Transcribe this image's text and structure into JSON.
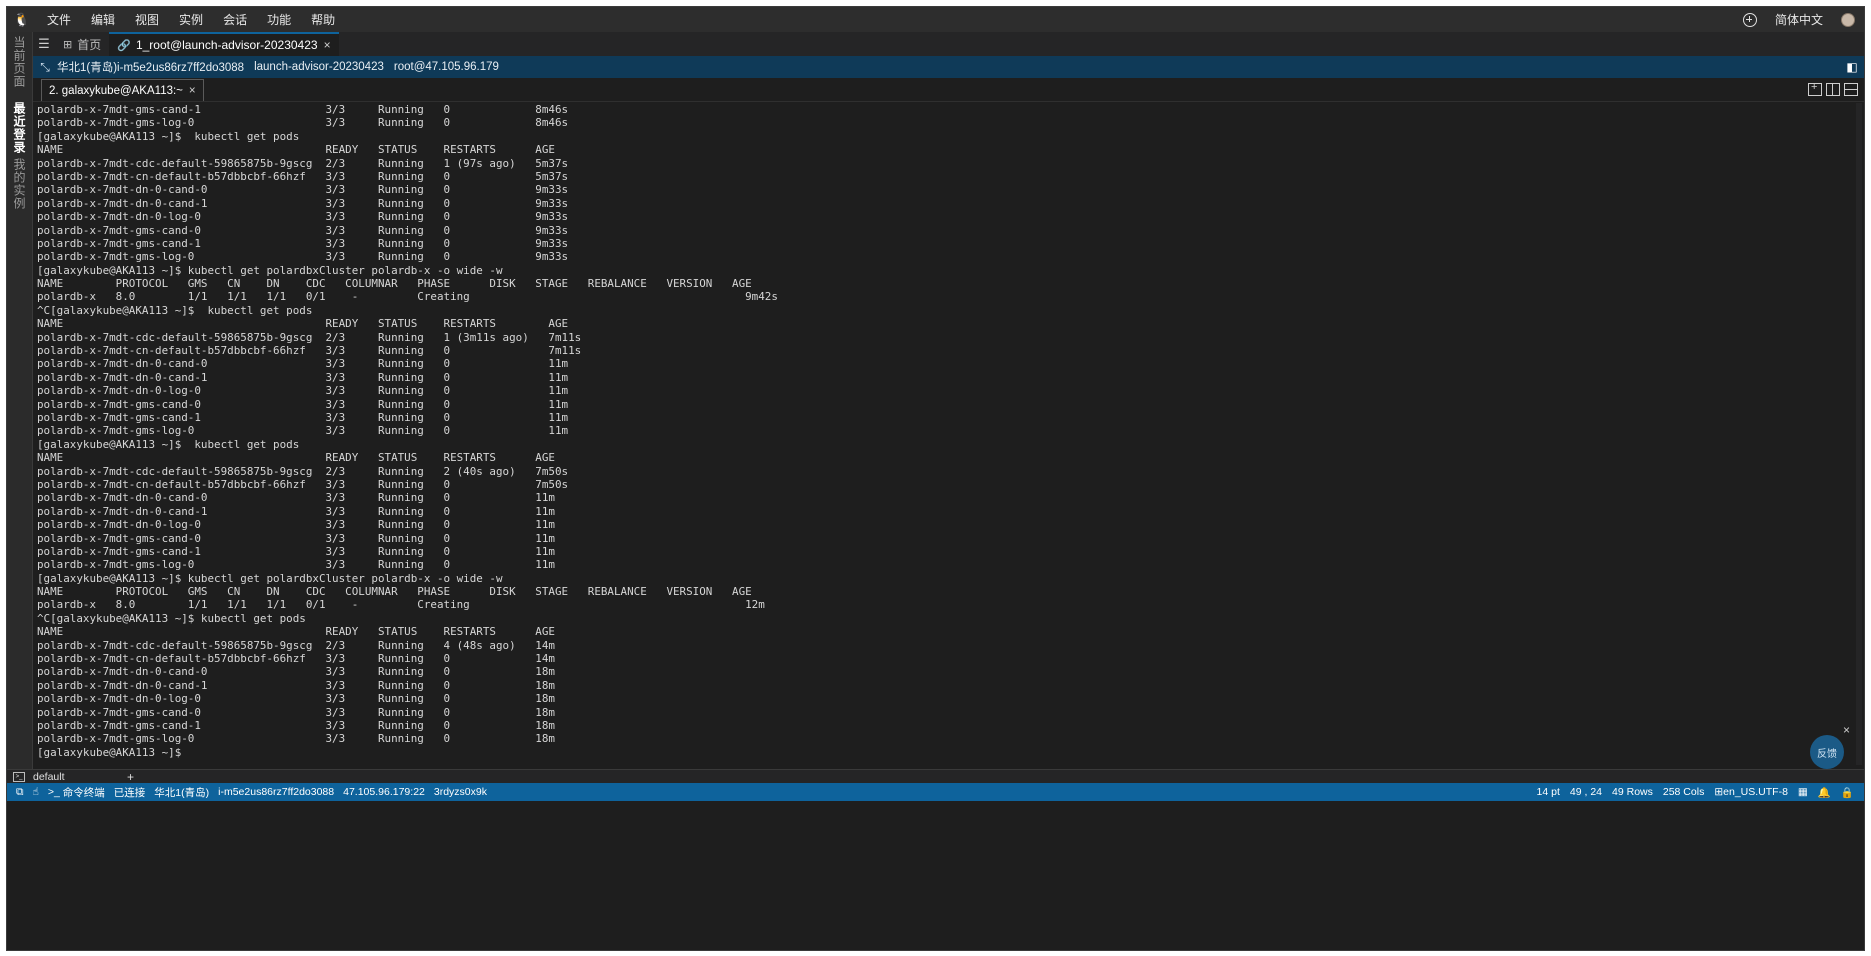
{
  "menubar": {
    "items": [
      "文件",
      "编辑",
      "视图",
      "实例",
      "会话",
      "功能",
      "帮助"
    ],
    "language": "简体中文"
  },
  "siderail": {
    "current_page": "当前页面",
    "recent": "最近登录",
    "my_instances": "我的实例"
  },
  "tabs": {
    "home": "首页",
    "session": "1_root@launch-advisor-20230423"
  },
  "infobar": {
    "region": "华北1(青岛)i-m5e2us86rz7ff2do3088",
    "instance_name": "launch-advisor-20230423",
    "login": "root@47.105.96.179"
  },
  "terminal_tab": {
    "label": "2. galaxykube@AKA113:~"
  },
  "terminal_lines": [
    "polardb-x-7mdt-gms-cand-1                   3/3     Running   0             8m46s",
    "polardb-x-7mdt-gms-log-0                    3/3     Running   0             8m46s",
    "[galaxykube@AKA113 ~]$  kubectl get pods",
    "NAME                                        READY   STATUS    RESTARTS      AGE",
    "polardb-x-7mdt-cdc-default-59865875b-9gscg  2/3     Running   1 (97s ago)   5m37s",
    "polardb-x-7mdt-cn-default-b57dbbcbf-66hzf   3/3     Running   0             5m37s",
    "polardb-x-7mdt-dn-0-cand-0                  3/3     Running   0             9m33s",
    "polardb-x-7mdt-dn-0-cand-1                  3/3     Running   0             9m33s",
    "polardb-x-7mdt-dn-0-log-0                   3/3     Running   0             9m33s",
    "polardb-x-7mdt-gms-cand-0                   3/3     Running   0             9m33s",
    "polardb-x-7mdt-gms-cand-1                   3/3     Running   0             9m33s",
    "polardb-x-7mdt-gms-log-0                    3/3     Running   0             9m33s",
    "[galaxykube@AKA113 ~]$ kubectl get polardbxCluster polardb-x -o wide -w",
    "NAME        PROTOCOL   GMS   CN    DN    CDC   COLUMNAR   PHASE      DISK   STAGE   REBALANCE   VERSION   AGE",
    "polardb-x   8.0        1/1   1/1   1/1   0/1    -         Creating                                          9m42s",
    "^C[galaxykube@AKA113 ~]$  kubectl get pods",
    "NAME                                        READY   STATUS    RESTARTS        AGE",
    "polardb-x-7mdt-cdc-default-59865875b-9gscg  2/3     Running   1 (3m11s ago)   7m11s",
    "polardb-x-7mdt-cn-default-b57dbbcbf-66hzf   3/3     Running   0               7m11s",
    "polardb-x-7mdt-dn-0-cand-0                  3/3     Running   0               11m",
    "polardb-x-7mdt-dn-0-cand-1                  3/3     Running   0               11m",
    "polardb-x-7mdt-dn-0-log-0                   3/3     Running   0               11m",
    "polardb-x-7mdt-gms-cand-0                   3/3     Running   0               11m",
    "polardb-x-7mdt-gms-cand-1                   3/3     Running   0               11m",
    "polardb-x-7mdt-gms-log-0                    3/3     Running   0               11m",
    "[galaxykube@AKA113 ~]$  kubectl get pods",
    "NAME                                        READY   STATUS    RESTARTS      AGE",
    "polardb-x-7mdt-cdc-default-59865875b-9gscg  2/3     Running   2 (40s ago)   7m50s",
    "polardb-x-7mdt-cn-default-b57dbbcbf-66hzf   3/3     Running   0             7m50s",
    "polardb-x-7mdt-dn-0-cand-0                  3/3     Running   0             11m",
    "polardb-x-7mdt-dn-0-cand-1                  3/3     Running   0             11m",
    "polardb-x-7mdt-dn-0-log-0                   3/3     Running   0             11m",
    "polardb-x-7mdt-gms-cand-0                   3/3     Running   0             11m",
    "polardb-x-7mdt-gms-cand-1                   3/3     Running   0             11m",
    "polardb-x-7mdt-gms-log-0                    3/3     Running   0             11m",
    "[galaxykube@AKA113 ~]$ kubectl get polardbxCluster polardb-x -o wide -w",
    "NAME        PROTOCOL   GMS   CN    DN    CDC   COLUMNAR   PHASE      DISK   STAGE   REBALANCE   VERSION   AGE",
    "polardb-x   8.0        1/1   1/1   1/1   0/1    -         Creating                                          12m",
    "^C[galaxykube@AKA113 ~]$ kubectl get pods",
    "NAME                                        READY   STATUS    RESTARTS      AGE",
    "polardb-x-7mdt-cdc-default-59865875b-9gscg  2/3     Running   4 (48s ago)   14m",
    "polardb-x-7mdt-cn-default-b57dbbcbf-66hzf   3/3     Running   0             14m",
    "polardb-x-7mdt-dn-0-cand-0                  3/3     Running   0             18m",
    "polardb-x-7mdt-dn-0-cand-1                  3/3     Running   0             18m",
    "polardb-x-7mdt-dn-0-log-0                   3/3     Running   0             18m",
    "polardb-x-7mdt-gms-cand-0                   3/3     Running   0             18m",
    "polardb-x-7mdt-gms-cand-1                   3/3     Running   0             18m",
    "polardb-x-7mdt-gms-log-0                    3/3     Running   0             18m",
    "[galaxykube@AKA113 ~]$ "
  ],
  "feedback": "反馈",
  "panel": {
    "name": "default"
  },
  "statusbar": {
    "command_terminal": "命令终端",
    "connection": "已连接",
    "region": "华北1(青岛)",
    "instance_id": "i-m5e2us86rz7ff2do3088",
    "address": "47.105.96.179:22",
    "session_id": "3rdyzs0x9k",
    "font_size": "14 pt",
    "cursor": "49 , 24",
    "rows": "49 Rows",
    "cols": "258 Cols",
    "locale": "en_US.UTF-8"
  },
  "colors": {
    "accent": "#0e639c",
    "infobar": "#0f3a58",
    "terminal_bg": "#1e1e1e"
  }
}
